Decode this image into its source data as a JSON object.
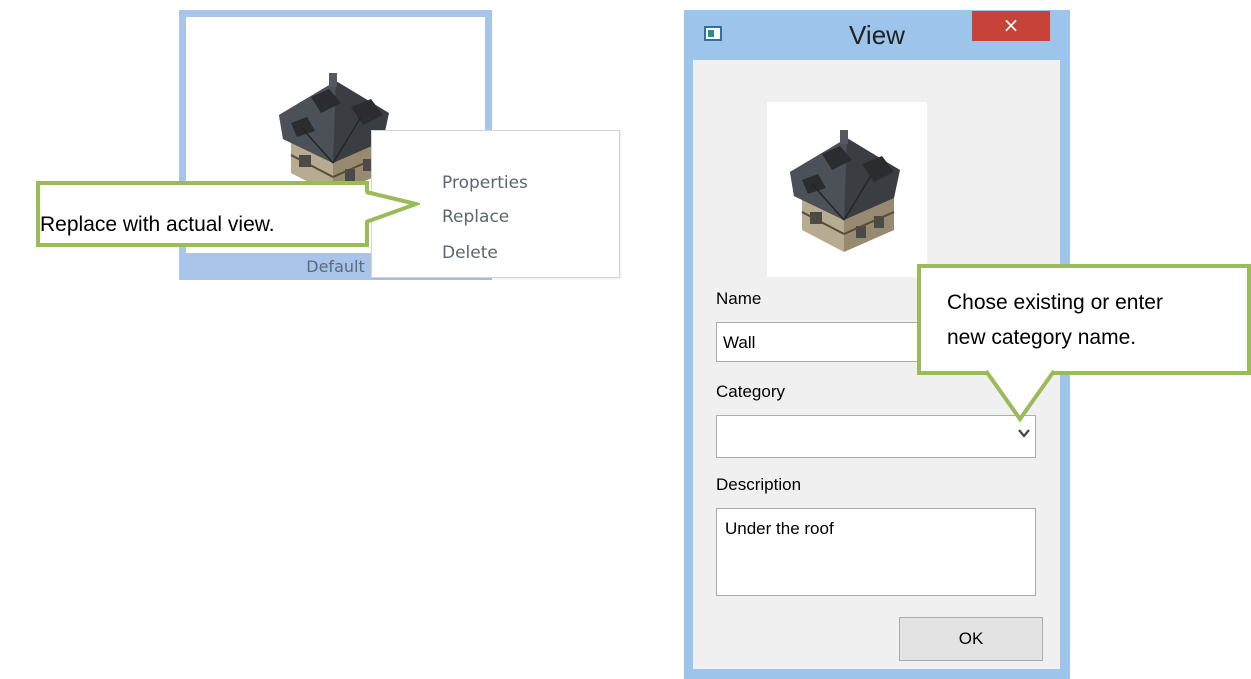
{
  "thumbnail": {
    "caption": "Default",
    "selection_color": "#a9c4e9"
  },
  "context_menu": {
    "items": [
      {
        "label": "Properties"
      },
      {
        "label": "Replace"
      },
      {
        "label": "Delete"
      }
    ]
  },
  "callouts": {
    "replace": "Replace with actual view.",
    "category_line1": "Chose existing or enter",
    "category_line2": "new category name.",
    "border_color": "#9bbb59"
  },
  "dialog": {
    "title": "View",
    "close_glyph": "×",
    "name_label": "Name",
    "name_value": "Wall",
    "category_label": "Category",
    "category_value": "",
    "description_label": "Description",
    "description_value": "Under the roof",
    "ok_label": "OK",
    "close_color": "#c7433a",
    "frame_color": "#9dc4ea"
  }
}
